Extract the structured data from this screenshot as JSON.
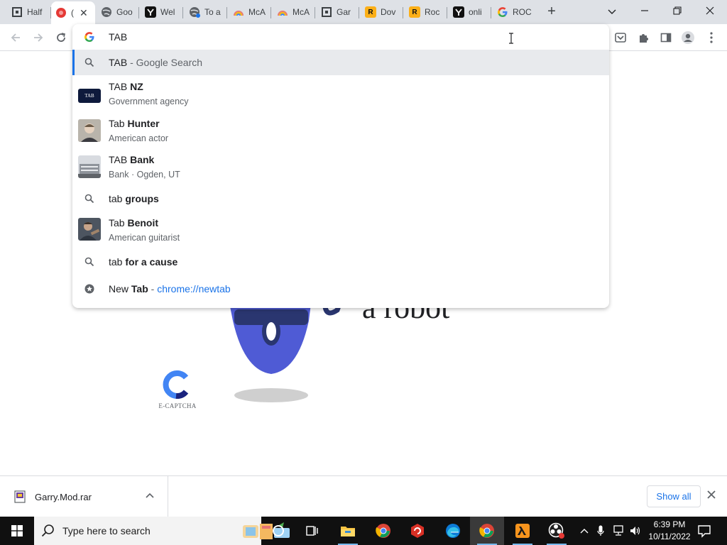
{
  "browser": {
    "tabs": [
      {
        "label": "Half",
        "icon": "gamebanana-icon",
        "color": "#3c4043"
      },
      {
        "label": "(",
        "icon": "recording-icon",
        "color": "#e53935",
        "active": true
      },
      {
        "label": "Goo",
        "icon": "globe-icon",
        "color": "#5f6368"
      },
      {
        "label": "Wel",
        "icon": "y-logo-icon",
        "color": "#111111"
      },
      {
        "label": "To a",
        "icon": "globe-icon",
        "color": "#5f6368"
      },
      {
        "label": "McA",
        "icon": "rainbow-icon",
        "color": "#e67c73"
      },
      {
        "label": "McA",
        "icon": "rainbow-icon",
        "color": "#e67c73"
      },
      {
        "label": "Gar",
        "icon": "gamebanana-icon",
        "color": "#3c4043"
      },
      {
        "label": "Dov",
        "icon": "rockstar-icon",
        "color": "#fcaf17"
      },
      {
        "label": "Roc",
        "icon": "rockstar-icon",
        "color": "#fcaf17"
      },
      {
        "label": "onli",
        "icon": "y-logo-icon",
        "color": "#111111"
      },
      {
        "label": "ROC",
        "icon": "google-icon",
        "color": "#4285f4"
      }
    ],
    "new_tab_symbol": "+",
    "window_controls": {
      "chevron": "⌄",
      "minimize": "—",
      "restore": "❐",
      "close": "✕"
    }
  },
  "omnibox": {
    "query": "TAB",
    "suggestions": [
      {
        "kind": "search",
        "prefix": "TAB",
        "bold": "",
        "dim": " - Google Search",
        "highlight": true
      },
      {
        "kind": "entity",
        "prefix": "TAB ",
        "bold": "NZ",
        "subtitle": "Government agency",
        "thumb": "tab-nz-logo",
        "thumb_text": "TAB"
      },
      {
        "kind": "entity",
        "prefix": "Tab ",
        "bold": "Hunter",
        "subtitle": "American actor",
        "thumb": "portrait"
      },
      {
        "kind": "entity",
        "prefix": "TAB ",
        "bold": "Bank",
        "subtitle": "Bank · Ogden, UT",
        "thumb": "building"
      },
      {
        "kind": "search",
        "prefix": "tab ",
        "bold": "groups"
      },
      {
        "kind": "entity",
        "prefix": "Tab ",
        "bold": "Benoit",
        "subtitle": "American guitarist",
        "thumb": "portrait"
      },
      {
        "kind": "search",
        "prefix": "tab ",
        "bold": "for a cause"
      },
      {
        "kind": "navigation",
        "prefix": "New ",
        "bold": "Tab",
        "dim": " - ",
        "url": "chrome://newtab"
      }
    ]
  },
  "page": {
    "robot_text": "a robot",
    "captcha_label": "E-CAPTCHA"
  },
  "download_bar": {
    "file_name": "Garry.Mod.rar",
    "show_all": "Show all"
  },
  "taskbar": {
    "search_placeholder": "Type here to search",
    "clock_time": "6:39 PM",
    "clock_date": "10/11/2022"
  },
  "colors": {
    "accent_blue": "#1a73e8",
    "tabstrip": "#dee1e6",
    "taskbar": "#101010",
    "robot_blue": "#4f5bd5"
  }
}
